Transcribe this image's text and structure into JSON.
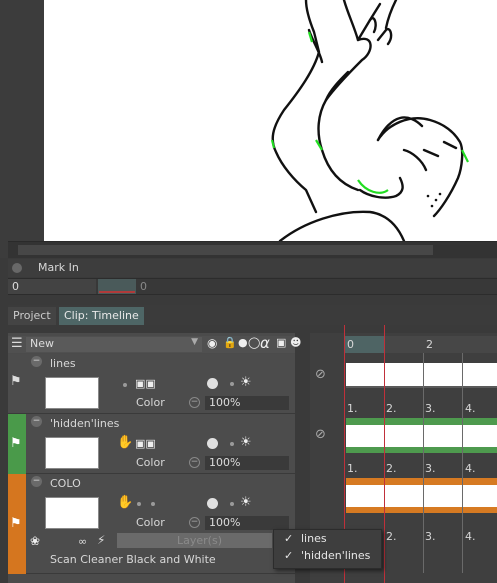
{
  "mark_in": {
    "label": "Mark In"
  },
  "frames": {
    "current": "0",
    "end": "0",
    "ticks": [
      "0",
      "2"
    ],
    "numbers": [
      "1.",
      "2.",
      "3.",
      "4."
    ]
  },
  "tabs": [
    {
      "label": "Project"
    },
    {
      "label": "Clip: Timeline"
    }
  ],
  "layer_header": {
    "name": "New"
  },
  "layers": [
    {
      "name": "lines",
      "color_label": "Color",
      "opacity": "100%"
    },
    {
      "name": "'hidden'lines",
      "color_label": "Color",
      "opacity": "100%"
    },
    {
      "name": "COLO",
      "color_label": "Color",
      "opacity": "100%",
      "field_text": "Layer(s)",
      "effect": "Scan Cleaner Black and White"
    }
  ],
  "context_menu": [
    {
      "label": "lines",
      "checked": true
    },
    {
      "label": "'hidden'lines",
      "checked": true
    }
  ],
  "colors": {
    "green_tag": "#4a9a4a",
    "orange_tag": "#d5761f",
    "playhead": "#c0303a",
    "green_bar": "#4e9a4e",
    "orange_bar": "#d67a22"
  }
}
